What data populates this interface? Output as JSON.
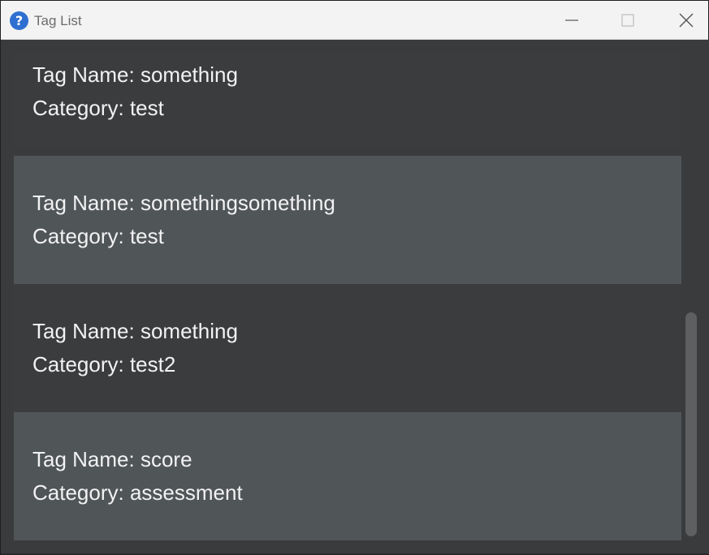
{
  "window": {
    "title": "Tag List",
    "app_icon_glyph": "?",
    "icons": {
      "app": "help-question-icon",
      "minimize": "minimize-icon",
      "maximize": "maximize-icon",
      "close": "close-icon"
    }
  },
  "tags": [
    {
      "name_line": "Tag Name: something",
      "category_line": "Category: test"
    },
    {
      "name_line": "Tag Name: somethingsomething",
      "category_line": "Category: test"
    },
    {
      "name_line": "Tag Name: something",
      "category_line": "Category: test2"
    },
    {
      "name_line": "Tag Name: score",
      "category_line": "Category: assessment"
    }
  ],
  "colors": {
    "row_dark": "#3b3c3e",
    "row_light": "#505558",
    "text": "#f2f2f2",
    "title_bar": "#f3f3f3",
    "accent": "#2f6fd1"
  }
}
